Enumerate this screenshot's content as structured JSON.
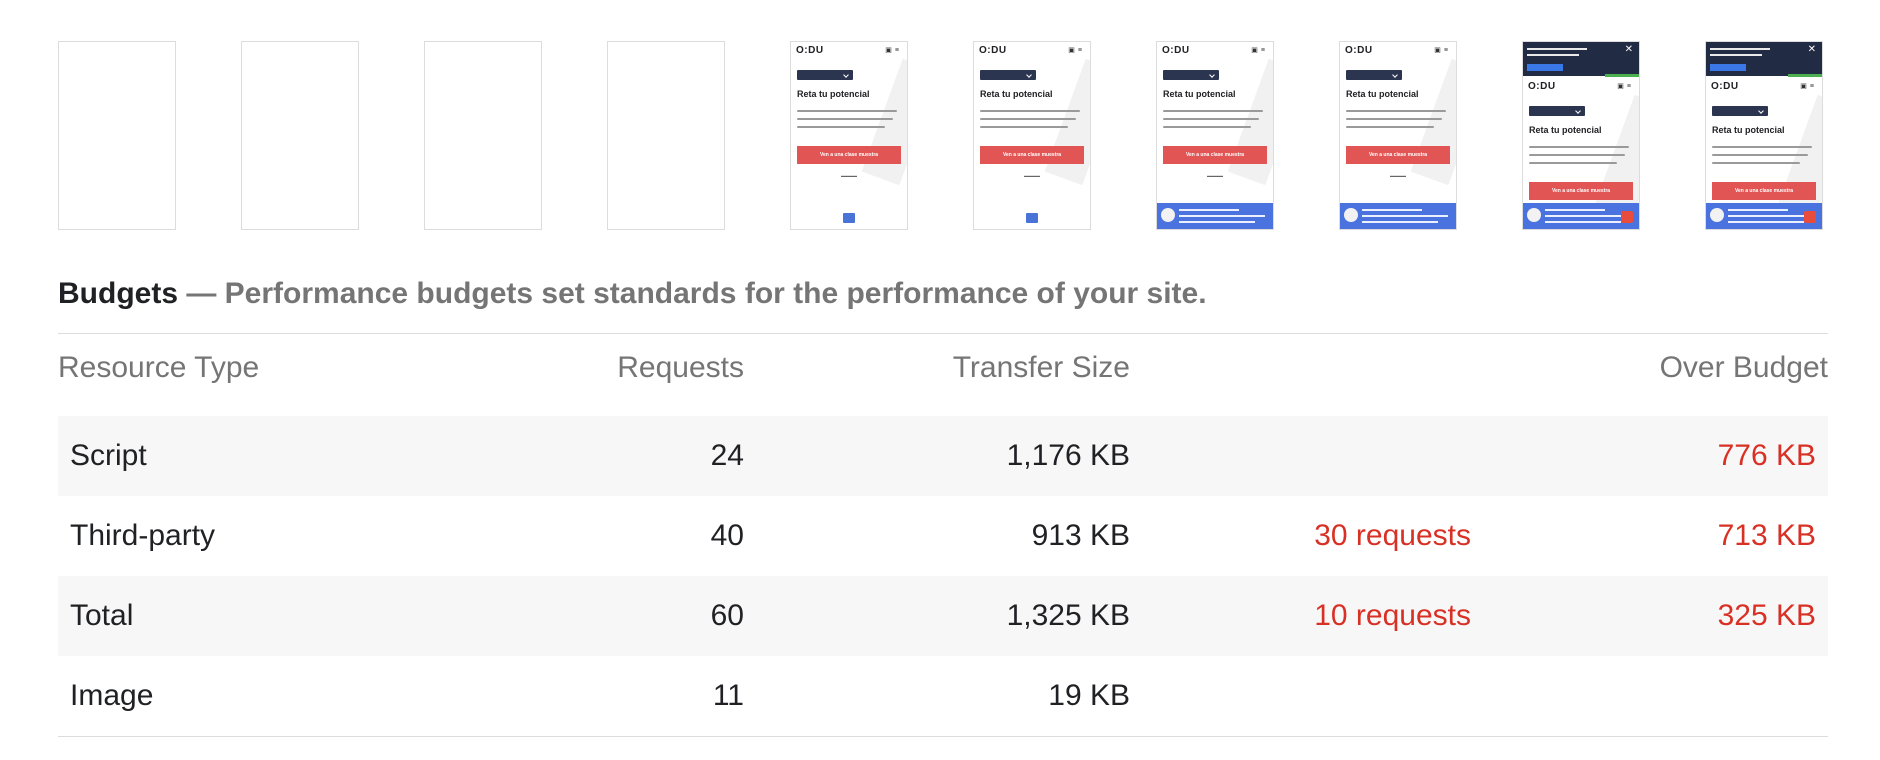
{
  "filmstrip": {
    "frames": [
      {
        "state": "blank"
      },
      {
        "state": "blank"
      },
      {
        "state": "blank"
      },
      {
        "state": "blank"
      },
      {
        "state": "loaded",
        "chat": true,
        "banner": false,
        "notice": false
      },
      {
        "state": "loaded",
        "chat": true,
        "banner": false,
        "notice": false
      },
      {
        "state": "loaded",
        "chat": false,
        "banner": true,
        "notice": false
      },
      {
        "state": "loaded",
        "chat": false,
        "banner": true,
        "notice": false
      },
      {
        "state": "loaded",
        "chat": false,
        "banner": true,
        "notice": true
      },
      {
        "state": "loaded",
        "chat": false,
        "banner": true,
        "notice": true
      }
    ],
    "logo_text": "O:DU",
    "hero_title": "Reta tu potencial",
    "cta_text": "Ven a una clase muestra",
    "colors": {
      "cta": "#e25555",
      "banner": "#4a73e0",
      "notice": "#222b44",
      "badge": "#2c3550"
    }
  },
  "budgets": {
    "title": "Budgets",
    "separator": " — ",
    "description": "Performance budgets set standards for the performance of your site.",
    "columns": {
      "resource_type": "Resource Type",
      "requests": "Requests",
      "transfer_size": "Transfer Size",
      "over_budget": "Over Budget"
    },
    "rows": [
      {
        "resource_type": "Script",
        "requests": "24",
        "transfer_size": "1,176 KB",
        "over_requests": "",
        "over_budget": "776 KB"
      },
      {
        "resource_type": "Third-party",
        "requests": "40",
        "transfer_size": "913 KB",
        "over_requests": "30 requests",
        "over_budget": "713 KB"
      },
      {
        "resource_type": "Total",
        "requests": "60",
        "transfer_size": "1,325 KB",
        "over_requests": "10 requests",
        "over_budget": "325 KB"
      },
      {
        "resource_type": "Image",
        "requests": "11",
        "transfer_size": "19 KB",
        "over_requests": "",
        "over_budget": ""
      }
    ],
    "colors": {
      "over": "#d93025",
      "muted": "#757575",
      "shaded_row": "#f7f7f7"
    }
  }
}
